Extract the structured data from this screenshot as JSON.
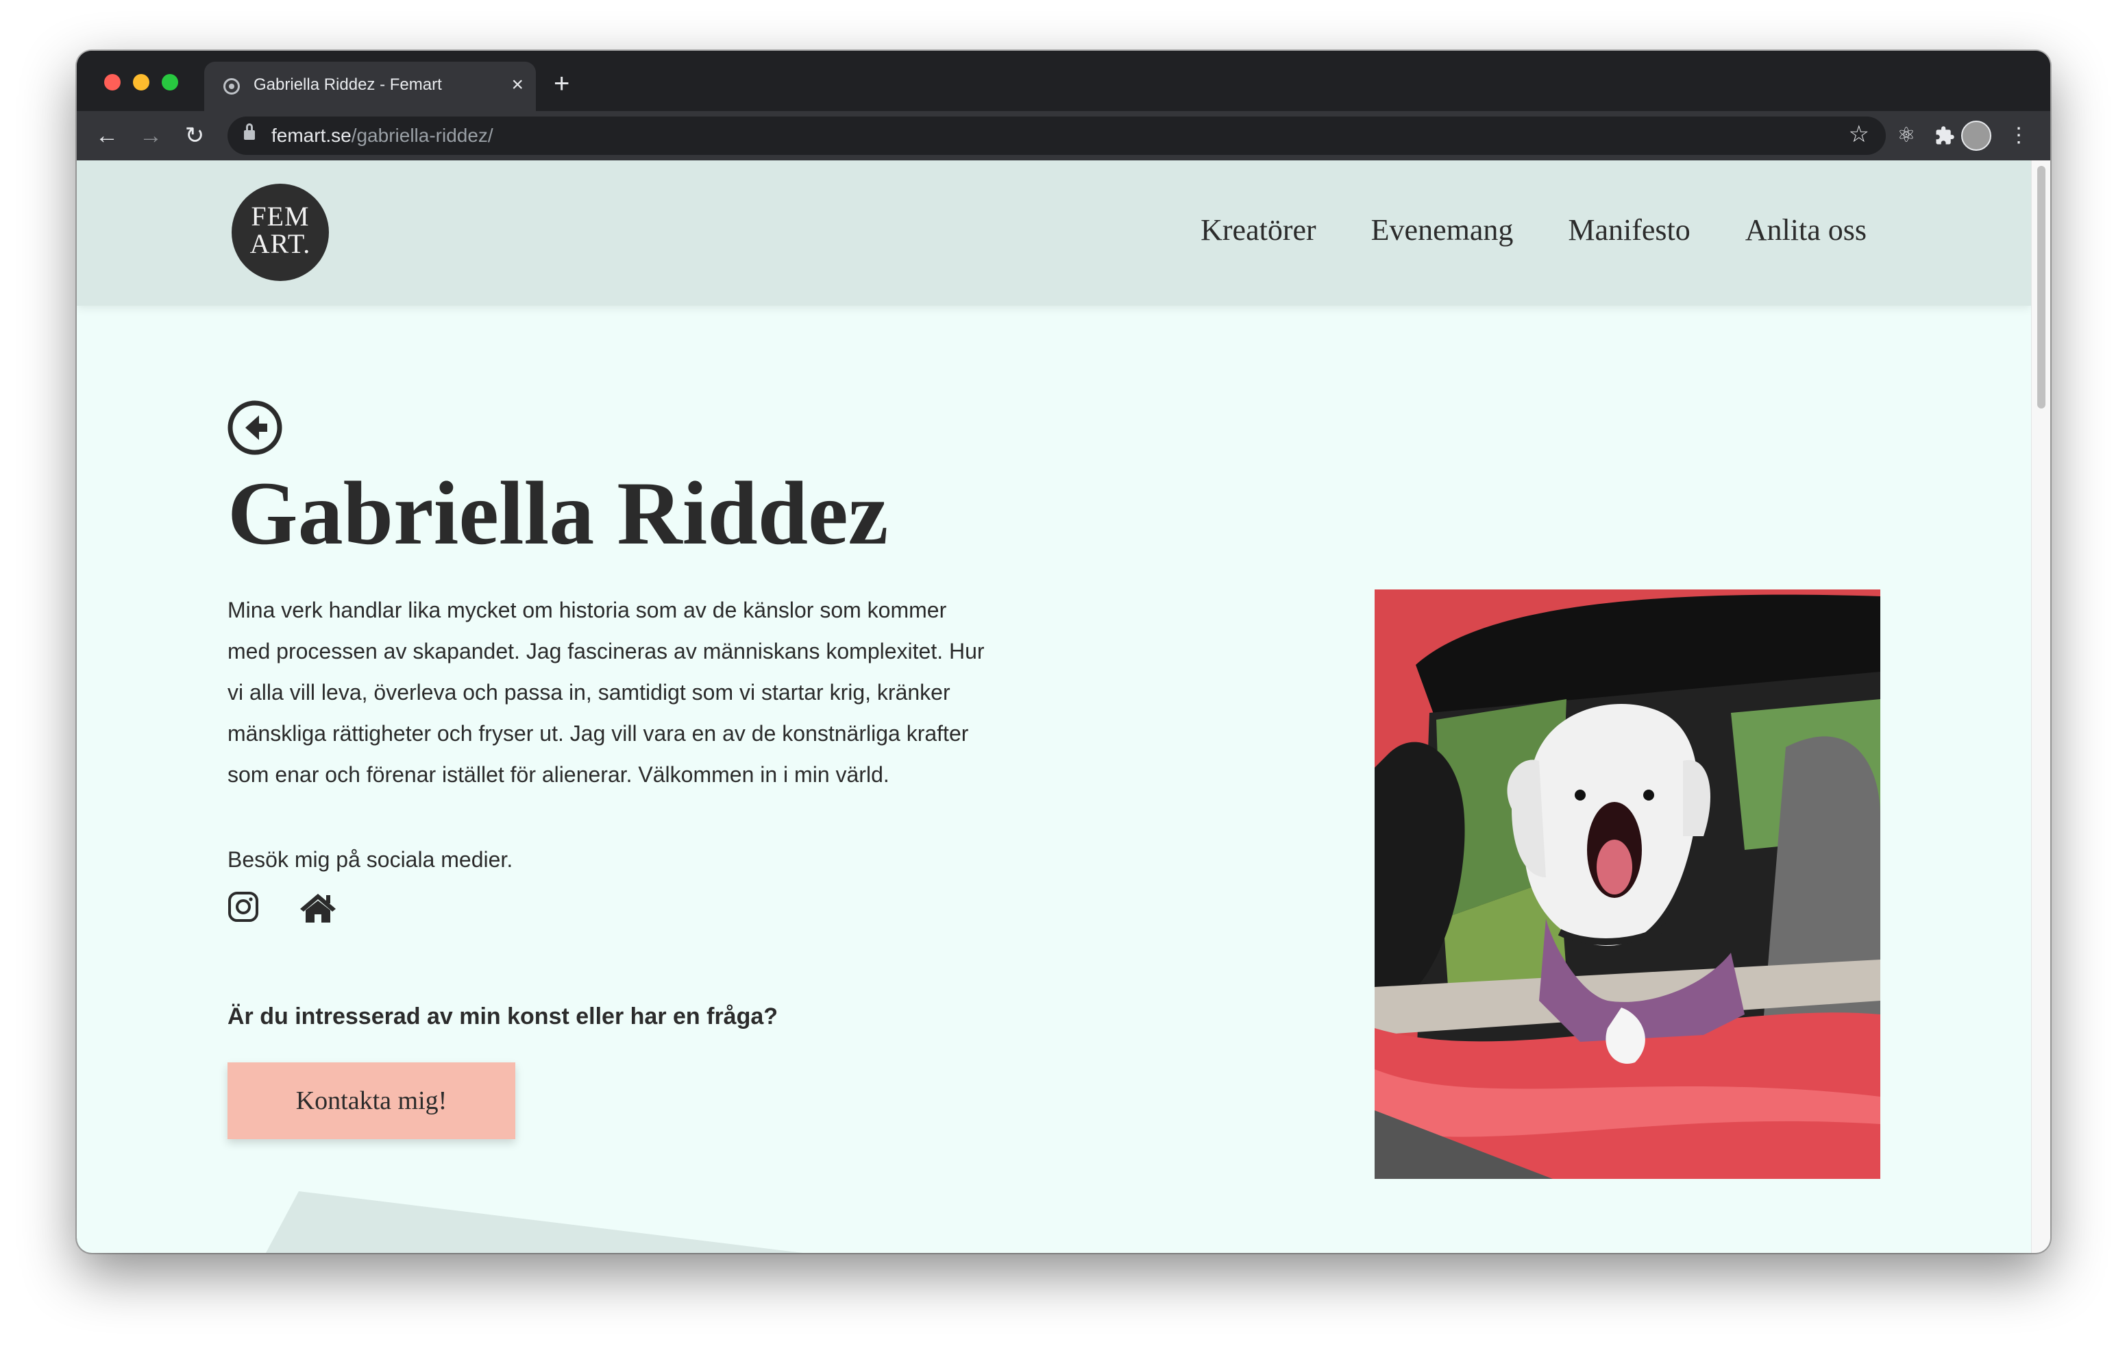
{
  "browser": {
    "tab": {
      "title": "Gabriella Riddez - Femart",
      "close": "×"
    },
    "new_tab": "+",
    "nav": {
      "back": "←",
      "forward": "→",
      "reload": "↻"
    },
    "url": {
      "host": "femart.se",
      "path": "/gabriella-riddez/"
    },
    "bookmark": "☆",
    "icons": {
      "extension_react": "⚛",
      "extensions": "✦",
      "menu": "⋮"
    }
  },
  "site": {
    "logo": {
      "line1": "FEM",
      "line2": "ART."
    },
    "nav": [
      "Kreatörer",
      "Evenemang",
      "Manifesto",
      "Anlita oss"
    ]
  },
  "artist": {
    "name": "Gabriella Riddez",
    "bio_lines": [
      "Mina verk handlar lika mycket om historia som av de känslor som kommer",
      "med processen av skapandet. Jag fascineras av människans komplexitet. Hur",
      "vi alla vill leva, överleva och passa in, samtidigt som vi startar krig, kränker",
      "mänskliga rättigheter och fryser ut. Jag vill vara en av de konstnärliga krafter",
      "som enar och förenar istället för alienerar. Välkommen in i min värld."
    ],
    "social_label": "Besök mig på sociala medier.",
    "social_icons": [
      "instagram-icon",
      "home-icon"
    ],
    "cta_question": "Är du intresserad av min konst eller har en fråga?",
    "cta_button": "Kontakta mig!"
  },
  "colors": {
    "page_bg": "#effdfa",
    "header_bg": "#d9e8e5",
    "button_bg": "#f7bcae",
    "text": "#2b2b2b"
  }
}
